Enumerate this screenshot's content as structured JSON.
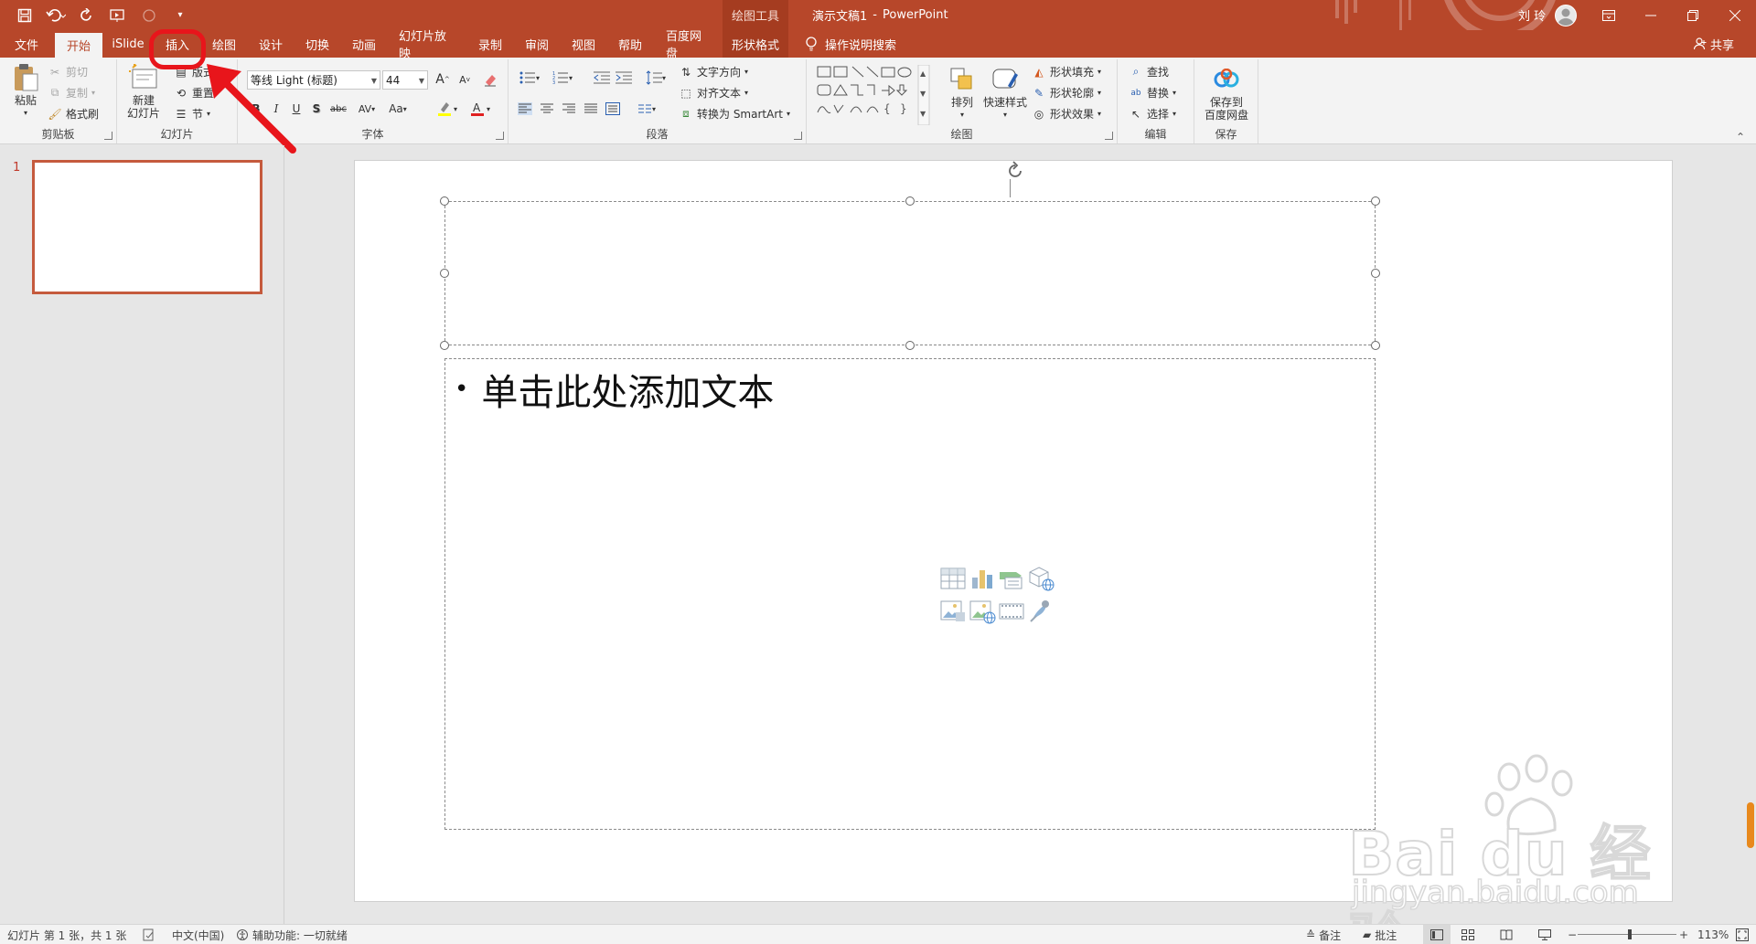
{
  "titlebar": {
    "context_tool": "绘图工具",
    "doc_name": "演示文稿1",
    "separator": "-",
    "app_name": "PowerPoint",
    "user_name": "刘 玲"
  },
  "tabs": [
    "文件",
    "开始",
    "iSlide",
    "插入",
    "绘图",
    "设计",
    "切换",
    "动画",
    "幻灯片放映",
    "录制",
    "审阅",
    "视图",
    "帮助",
    "百度网盘",
    "形状格式"
  ],
  "active_tab": "开始",
  "tell_me": "操作说明搜索",
  "share": "共享",
  "ribbon": {
    "clipboard": {
      "paste": "粘贴",
      "cut": "剪切",
      "copy": "复制",
      "format_painter": "格式刷",
      "label": "剪贴板"
    },
    "slides": {
      "new_slide_1": "新建",
      "new_slide_2": "幻灯片",
      "layout": "版式",
      "reset": "重置",
      "section": "节",
      "label": "幻灯片"
    },
    "font": {
      "font_name": "等线 Light (标题)",
      "font_size": "44",
      "grow": "A",
      "shrink": "A",
      "bold": "B",
      "italic": "I",
      "underline": "U",
      "shadow": "S",
      "strike": "abc",
      "spacing": "AV",
      "case": "Aa",
      "label": "字体"
    },
    "paragraph": {
      "text_direction": "文字方向",
      "align_text": "对齐文本",
      "smartart": "转换为 SmartArt",
      "label": "段落"
    },
    "drawing": {
      "arrange": "排列",
      "quick_styles": "快速样式",
      "shape_fill": "形状填充",
      "shape_outline": "形状轮廓",
      "shape_effects": "形状效果",
      "label": "绘图"
    },
    "editing": {
      "find": "查找",
      "replace": "替换",
      "select": "选择",
      "label": "编辑"
    },
    "save": {
      "save_to_1": "保存到",
      "save_to_2": "百度网盘",
      "label": "保存"
    }
  },
  "slides_pane": {
    "number": "1"
  },
  "slide": {
    "body_placeholder": "单击此处添加文本",
    "bullet": "•"
  },
  "statusbar": {
    "slide_info": "幻灯片 第 1 张，共 1 张",
    "language": "中文(中国)",
    "accessibility": "辅助功能: 一切就绪",
    "notes": "备注",
    "comments": "批注",
    "zoom_minus": "−",
    "zoom_plus": "+",
    "zoom": "113%"
  },
  "watermark": {
    "brand": "Bai du 经验",
    "url": "jingyan.baidu.com"
  },
  "colors": {
    "brand": "#b7472a",
    "highlight": "#e8151b",
    "ribbon_bg": "#f3f3f3"
  }
}
